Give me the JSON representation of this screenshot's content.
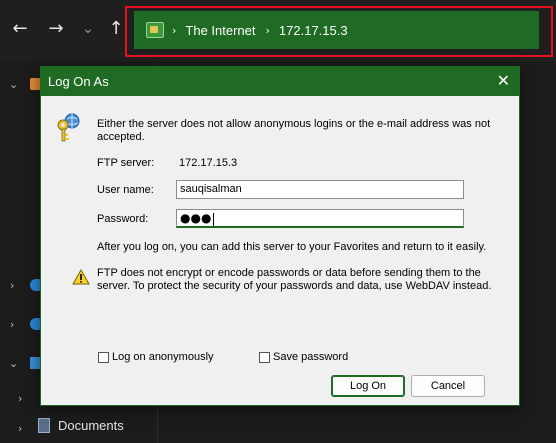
{
  "address_bar": {
    "crumbs": [
      "The Internet",
      "172.17.15.3"
    ],
    "separator": "›"
  },
  "nav": {
    "back": "←",
    "forward": "→",
    "recent": "⌄",
    "up": "↑"
  },
  "sidebar": {
    "documents_label": "Documents"
  },
  "dialog": {
    "title": "Log On As",
    "close_glyph": "✕",
    "intro": "Either the server does not allow anonymous logins or the e-mail address was not accepted.",
    "ftp_server_label": "FTP server:",
    "ftp_server_value": "172.17.15.3",
    "username_label": "User name:",
    "username_value": "sauqisalman",
    "password_label": "Password:",
    "password_mask": "●●●",
    "after_logon_text": "After you log on, you can add this server to your Favorites and return to it easily.",
    "warning_text": "FTP does not encrypt or encode passwords or data before sending them to the server.  To protect the security of your passwords and data, use WebDAV instead.",
    "anonymous_label": "Log on anonymously",
    "save_password_label": "Save password",
    "logon_button": "Log On",
    "cancel_button": "Cancel"
  },
  "colors": {
    "accent_green": "#1f6b24",
    "highlight_red": "#e81123",
    "dialog_bg": "#f0f0f0"
  }
}
